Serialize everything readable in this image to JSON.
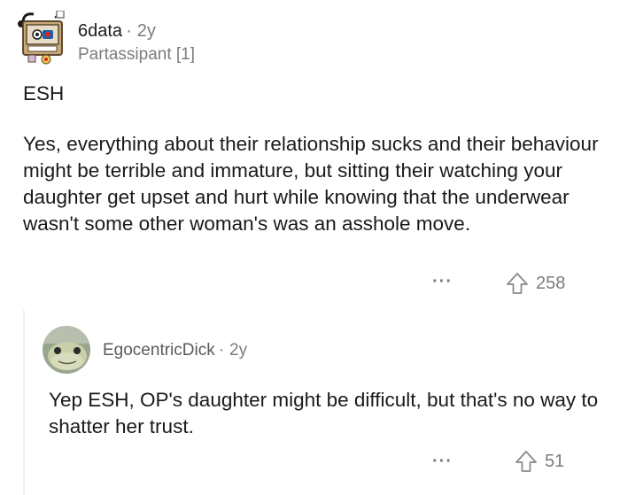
{
  "comment": {
    "username": "6data",
    "separator": "·",
    "age": "2y",
    "flair": "Partassipant [1]",
    "paragraphs": [
      "ESH",
      "Yes, everything about their relationship sucks and their behaviour might be terrible and immature, but sitting their watching your daughter get upset and hurt while knowing that the underwear wasn't some other woman's was an asshole move."
    ],
    "more_label": "···",
    "upvotes": "258"
  },
  "reply": {
    "username": "EgocentricDick",
    "separator": "·",
    "age": "2y",
    "body": "Yep ESH, OP's daughter might be difficult, but that's no way to shatter her trust.",
    "more_label": "···",
    "upvotes": "51"
  },
  "colors": {
    "text": "#1a1a1b",
    "meta": "#7c7c7c",
    "thread_line": "#edeff1"
  },
  "icons": {
    "upvote": "arrow-up-outline-icon",
    "more": "ellipsis-icon"
  }
}
